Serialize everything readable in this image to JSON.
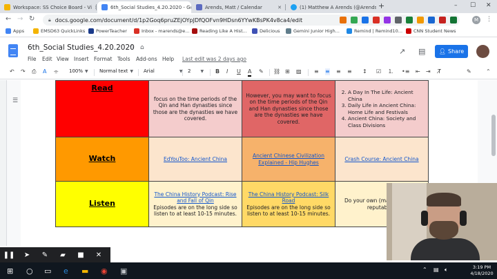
{
  "tabs": [
    {
      "label": "Workspace: SS Choice Board - Vi",
      "color": "#f4b400"
    },
    {
      "label": "6th_Social Studies_4.20.2020 - Go",
      "color": "#4285f4"
    },
    {
      "label": "Arends, Matt / Calendar",
      "color": "#5c6bc0"
    },
    {
      "label": "(1) Matthew A Arends (@Arends",
      "color": "#1da1f2"
    }
  ],
  "address": {
    "url": "docs.google.com/document/d/1p2Goq6pruZEjOYpJDfQOFvn9HDsn6YYwKBsPK4v8ca4/edit"
  },
  "bookmarks": [
    {
      "label": "Apps",
      "color": "#4285f4"
    },
    {
      "label": "EMSD63 QuickLinks",
      "color": "#f4b400"
    },
    {
      "label": "PowerTeacher",
      "color": "#1a3a8a"
    },
    {
      "label": "Inbox - marends@e...",
      "color": "#d93025"
    },
    {
      "label": "Reading Like A Hist...",
      "color": "#a50e0e"
    },
    {
      "label": "Delicious",
      "color": "#3f51b5"
    },
    {
      "label": "Gemini Junior High...",
      "color": "#607d8b"
    },
    {
      "label": "Remind | Remind10...",
      "color": "#1e88e5"
    },
    {
      "label": "CNN Student News",
      "color": "#cc0000"
    }
  ],
  "docs": {
    "title": "6th_Social Studies_4.20.2020",
    "menus": [
      "File",
      "Edit",
      "View",
      "Insert",
      "Format",
      "Tools",
      "Add-ons",
      "Help"
    ],
    "last_edit": "Last edit was 2 days ago",
    "share_label": "Share"
  },
  "toolbar": {
    "zoom": "100%",
    "style": "Normal text",
    "font": "Arial",
    "size": "2"
  },
  "choice_board": {
    "rows": [
      {
        "label": "Read",
        "color": "#ff0000",
        "cells": [
          {
            "text": "focus on the time periods of the Qin and Han dynasties since those are the dynasties we have covered.",
            "color": "#f4cccc"
          },
          {
            "text": "However, you may want to focus on the time periods of the Qin and Han dynasties since those are the dynasties we have covered.",
            "color": "#e06666"
          },
          {
            "list": [
              "A Day In The Life: Ancient China",
              "Daily Life in Ancient China: Home Life and Festivals",
              "Ancient China: Society and Class Divisions"
            ],
            "start": 2,
            "color": "#f4cccc"
          }
        ]
      },
      {
        "label": "Watch",
        "color": "#ff9900",
        "cells": [
          {
            "link": "EdYouToo: Ancient China",
            "color": "#fce5cd"
          },
          {
            "link": "Ancient Chinese Civilization Explained - Hip Hughes",
            "color": "#f6b26b"
          },
          {
            "link": "Crash Course: Ancient China",
            "color": "#fce5cd"
          }
        ]
      },
      {
        "label": "Listen",
        "color": "#ffff00",
        "cells": [
          {
            "link": "The China History Podcast: Rise and Fall of Qin",
            "text": "Episodes are on the long side so listen to at least 10-15 minutes.",
            "color": "#fff2cc"
          },
          {
            "link": "The China History Podcast: Silk Road",
            "text": "Episodes are on the long side so listen to at least 10-15 minutes.",
            "color": "#ffd966"
          },
          {
            "text": "Do your own (make sure you reputable s",
            "color": "#fff2cc"
          }
        ]
      }
    ]
  },
  "taskbar": {
    "time": "3:19 PM",
    "date": "4/18/2020"
  }
}
